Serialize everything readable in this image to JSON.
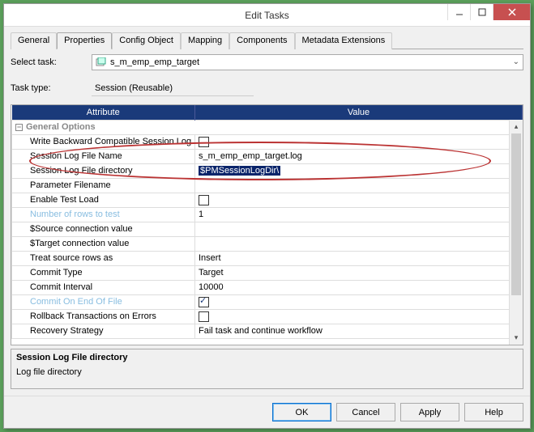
{
  "window": {
    "title": "Edit Tasks"
  },
  "tabs": {
    "general": "General",
    "properties": "Properties",
    "config_object": "Config Object",
    "mapping": "Mapping",
    "components": "Components",
    "metadata_ext": "Metadata Extensions"
  },
  "form": {
    "select_task_label": "Select task:",
    "select_task_value": "s_m_emp_emp_target",
    "task_type_label": "Task type:",
    "task_type_value": "Session (Reusable)"
  },
  "grid": {
    "header_attr": "Attribute",
    "header_val": "Value",
    "group": "General Options",
    "rows": [
      {
        "attr": "Write Backward Compatible Session Log File",
        "val": "",
        "check": false,
        "checkbox": true
      },
      {
        "attr": "Session Log File Name",
        "val": "s_m_emp_emp_target.log"
      },
      {
        "attr": "Session Log File directory",
        "val": "$PMSessionLogDir\\",
        "selected": true
      },
      {
        "attr": "Parameter Filename",
        "val": ""
      },
      {
        "attr": "Enable Test Load",
        "val": "",
        "check": false,
        "checkbox": true
      },
      {
        "attr": "Number of rows to test",
        "val": "1",
        "disabled": true
      },
      {
        "attr": "$Source connection value",
        "val": ""
      },
      {
        "attr": "$Target connection value",
        "val": ""
      },
      {
        "attr": "Treat source rows as",
        "val": "Insert"
      },
      {
        "attr": "Commit Type",
        "val": "Target"
      },
      {
        "attr": "Commit Interval",
        "val": "10000"
      },
      {
        "attr": "Commit On End Of File",
        "val": "",
        "check": true,
        "checkbox": true,
        "disabled": true
      },
      {
        "attr": "Rollback Transactions on Errors",
        "val": "",
        "check": false,
        "checkbox": true
      },
      {
        "attr": "Recovery Strategy",
        "val": "Fail task and continue workflow"
      }
    ]
  },
  "description": {
    "title": "Session Log File directory",
    "body": "Log file directory"
  },
  "buttons": {
    "ok": "OK",
    "cancel": "Cancel",
    "apply": "Apply",
    "help": "Help"
  }
}
